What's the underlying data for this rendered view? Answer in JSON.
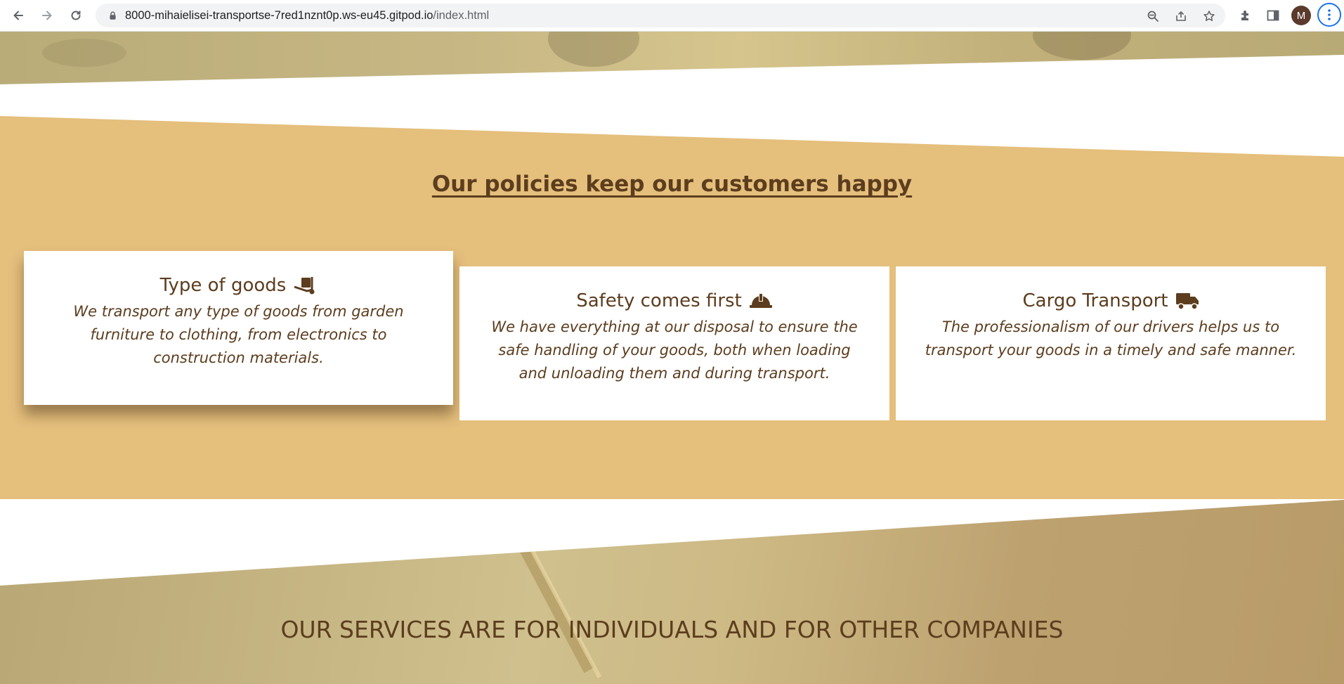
{
  "browser": {
    "url_host": "8000-mihaielisei-transportse-7red1nznt0p.ws-eu45.gitpod.io",
    "url_path": "/index.html",
    "profile_initial": "M",
    "icons": [
      "back-icon",
      "forward-icon",
      "reload-icon",
      "lock-icon",
      "zoom-icon",
      "share-icon",
      "star-icon",
      "extensions-icon",
      "side-panel-icon",
      "menu-icon"
    ]
  },
  "policies": {
    "title": "Our policies keep our customers happy",
    "cards": [
      {
        "title": "Type of goods",
        "icon": "dolly-icon",
        "text": "We transport any type of goods from garden furniture to clothing, from electronics to construction materials."
      },
      {
        "title": "Safety comes first",
        "icon": "hard-hat-icon",
        "text": "We have everything at our disposal to ensure the safe handling of your goods, both when loading and unloading them and during transport."
      },
      {
        "title": "Cargo Transport",
        "icon": "truck-icon",
        "text": "The professionalism of our drivers helps us to transport your goods in a timely and safe manner."
      }
    ]
  },
  "services": {
    "title": "OUR SERVICES ARE FOR INDIVIDUALS AND FOR OTHER COMPANIES"
  },
  "colors": {
    "accent_background": "#e5bf7c",
    "text_brown": "#5c3d1e",
    "card_background": "#ffffff"
  }
}
